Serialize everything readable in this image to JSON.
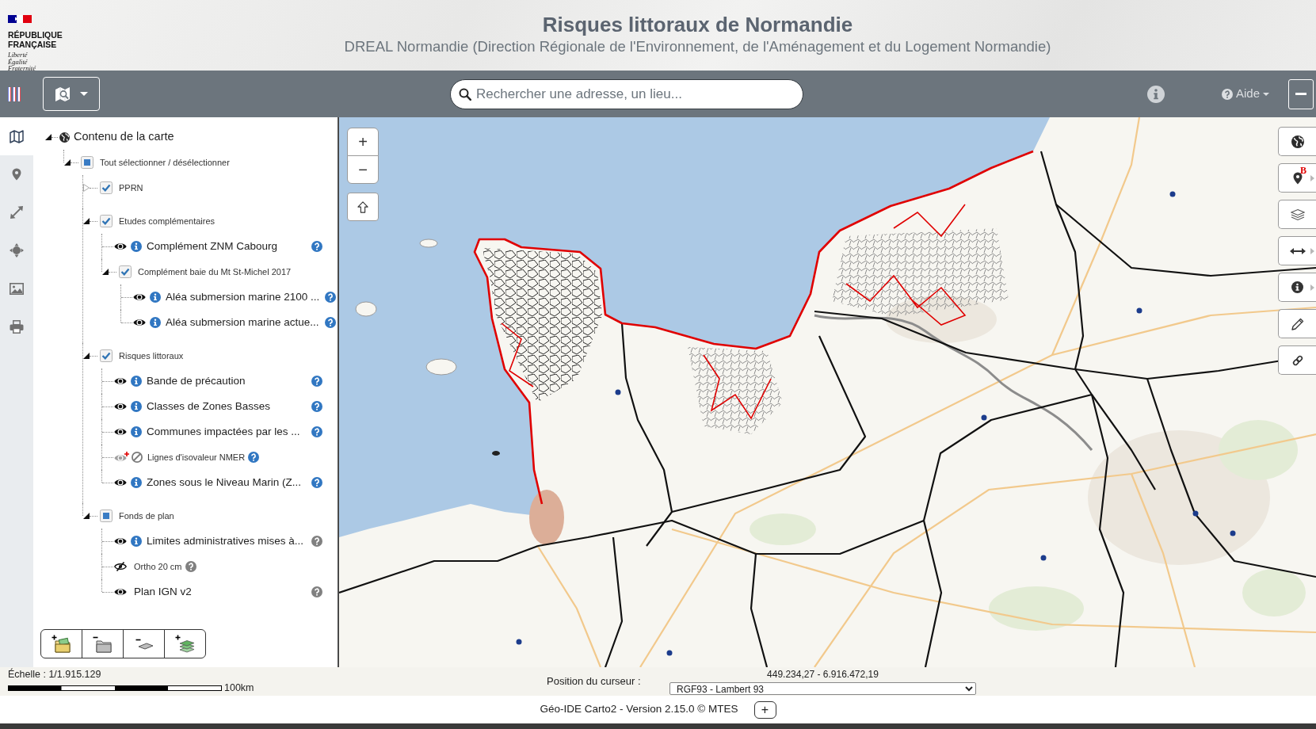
{
  "header": {
    "logo": {
      "name_lines": [
        "RÉPUBLIQUE",
        "FRANÇAISE"
      ],
      "motto": [
        "Liberté",
        "Égalité",
        "Fraternité"
      ]
    },
    "title": "Risques littoraux de Normandie",
    "subtitle": "DREAL Normandie (Direction Régionale de l'Environnement, de l'Aménagement et du Logement Normandie)"
  },
  "toolbar": {
    "search": {
      "placeholder": "Rechercher une adresse, un lieu..."
    },
    "help_menu": {
      "label": "Aide"
    }
  },
  "sidebar": {
    "items": [
      {
        "kind": "map",
        "selected": true
      },
      {
        "kind": "marker",
        "selected": false
      },
      {
        "kind": "expand",
        "selected": false
      },
      {
        "kind": "crosshair",
        "selected": false
      },
      {
        "kind": "image",
        "selected": false
      },
      {
        "kind": "print",
        "selected": false
      }
    ]
  },
  "layer_tree": {
    "label": "Contenu de la carte",
    "expanded": true,
    "children": [
      {
        "kind": "group",
        "label": "Tout sélectionner / désélectionner",
        "expanded": true,
        "checked": false,
        "indeterminate": true,
        "children": [
          {
            "kind": "group",
            "label": "PPRN",
            "expanded": false,
            "checked": true,
            "indeterminate": false
          },
          {
            "kind": "group",
            "label": "Etudes complémentaires",
            "expanded": true,
            "checked": true,
            "indeterminate": false,
            "children": [
              {
                "kind": "layer",
                "label": "Complément ZNM Cabourg",
                "visible": true,
                "available": true,
                "info": true,
                "help": {
                  "color": "#3177c2"
                }
              },
              {
                "kind": "group",
                "label": "Complément baie du Mt St-Michel 2017",
                "expanded": true,
                "checked": true,
                "indeterminate": false,
                "children": [
                  {
                    "kind": "layer",
                    "label": "Aléa submersion marine 2100 ...",
                    "visible": true,
                    "available": true,
                    "info": true,
                    "help": {
                      "color": "#3177c2"
                    }
                  },
                  {
                    "kind": "layer",
                    "label": "Aléa submersion marine actue...",
                    "visible": true,
                    "available": true,
                    "info": true,
                    "help": {
                      "color": "#3177c2"
                    }
                  }
                ]
              }
            ]
          },
          {
            "kind": "group",
            "label": "Risques littoraux",
            "expanded": true,
            "checked": true,
            "indeterminate": false,
            "children": [
              {
                "kind": "layer",
                "label": "Bande de précaution",
                "visible": true,
                "available": true,
                "info": true,
                "help": {
                  "color": "#3177c2"
                }
              },
              {
                "kind": "layer",
                "label": "Classes de Zones Basses",
                "visible": true,
                "available": true,
                "info": true,
                "help": {
                  "color": "#3177c2"
                }
              },
              {
                "kind": "layer",
                "label": "Communes impactées par les ...",
                "visible": true,
                "available": true,
                "info": true,
                "help": {
                  "color": "#3177c2"
                }
              },
              {
                "kind": "layer",
                "label": "Lignes d'isovaleur NMER",
                "visible": true,
                "available": false,
                "info": true,
                "help": {
                  "color": "#3177c2"
                }
              },
              {
                "kind": "layer",
                "label": "Zones sous le Niveau Marin (Z...",
                "visible": true,
                "available": true,
                "info": true,
                "help": {
                  "color": "#3177c2"
                }
              }
            ]
          },
          {
            "kind": "group",
            "label": "Fonds de plan",
            "expanded": true,
            "checked": false,
            "indeterminate": true,
            "children": [
              {
                "kind": "layer",
                "label": "Limites administratives mises à...",
                "visible": true,
                "available": true,
                "info": true,
                "help": {
                  "color": "#808080"
                }
              },
              {
                "kind": "layer",
                "label": "Ortho 20 cm",
                "visible": false,
                "available": true,
                "info": false,
                "help": {
                  "color": "#808080"
                }
              },
              {
                "kind": "layer",
                "label": "Plan IGN v2",
                "visible": true,
                "available": true,
                "info": false,
                "help": {
                  "color": "#808080"
                }
              }
            ]
          }
        ]
      }
    ]
  },
  "map": {
    "zoom_in": "+",
    "zoom_out": "−",
    "tools": [
      {
        "kind": "globe",
        "menu": false
      },
      {
        "kind": "marker",
        "badge": "B",
        "menu": true
      },
      {
        "kind": "layers",
        "menu": false
      },
      {
        "kind": "measure",
        "menu": true
      },
      {
        "kind": "info",
        "menu": true
      },
      {
        "kind": "pencil",
        "menu": false
      },
      {
        "kind": "link",
        "menu": false
      }
    ]
  },
  "status_bar": {
    "scale_label": "Échelle : 1/1.915.129",
    "scale_distance": "100km",
    "cursor_label": "Position du curseur :",
    "cursor_coords": "449.234,27 - 6.916.472,19",
    "projection": "RGF93 - Lambert 93"
  },
  "footer": {
    "text": "Géo-IDE Carto2 - Version 2.15.0 © MTES",
    "button": "+"
  }
}
